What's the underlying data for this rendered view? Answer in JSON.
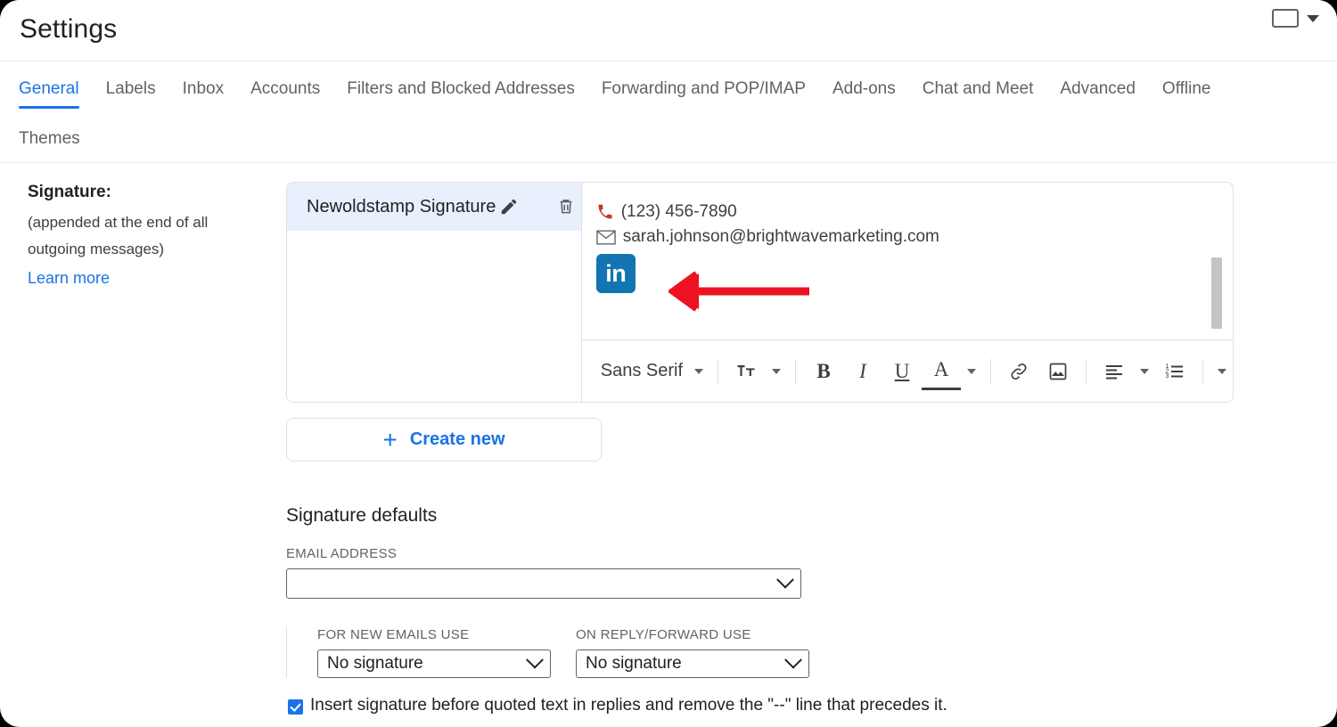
{
  "header": {
    "title": "Settings",
    "keyboard_icon": "keyboard-icon",
    "caret_icon": "chevron-down-icon"
  },
  "tabs": {
    "row1": [
      {
        "label": "General",
        "active": true
      },
      {
        "label": "Labels",
        "active": false
      },
      {
        "label": "Inbox",
        "active": false
      },
      {
        "label": "Accounts",
        "active": false
      },
      {
        "label": "Filters and Blocked Addresses",
        "active": false
      },
      {
        "label": "Forwarding and POP/IMAP",
        "active": false
      },
      {
        "label": "Add-ons",
        "active": false
      },
      {
        "label": "Chat and Meet",
        "active": false
      },
      {
        "label": "Advanced",
        "active": false
      },
      {
        "label": "Offline",
        "active": false
      }
    ],
    "row2": [
      {
        "label": "Themes",
        "active": false
      }
    ]
  },
  "signature_section": {
    "label_title": "Signature:",
    "label_sub_line1": "(appended at the end of all",
    "label_sub_line2": "outgoing messages)",
    "learn_more": "Learn more",
    "list": [
      {
        "name": "Newoldstamp Signature",
        "selected": true
      }
    ],
    "edit_icon": "pencil-icon",
    "delete_icon": "trash-icon",
    "editor": {
      "phone": "(123) 456-7890",
      "email": "sarah.johnson@brightwavemarketing.com",
      "linkedin_label": "in",
      "linkedin_color": "#1275b1",
      "phone_icon": "phone-icon",
      "mail_icon": "envelope-icon",
      "annotation_arrow_color": "#ee1122"
    },
    "toolbar": {
      "font_name": "Sans Serif",
      "text_size_icon": "text-size-icon",
      "bold_label": "B",
      "italic_label": "I",
      "underline_label": "U",
      "text_color_label": "A",
      "link_icon": "link-icon",
      "image_icon": "insert-image-icon",
      "align_icon": "align-left-icon",
      "list_icon": "numbered-list-icon",
      "more_icon": "more-options-icon"
    },
    "create_new": {
      "plus": "+",
      "label": "Create new"
    }
  },
  "signature_defaults": {
    "title": "Signature defaults",
    "email_address_label": "EMAIL ADDRESS",
    "email_address_value": "",
    "new_emails_label": "FOR NEW EMAILS USE",
    "new_emails_value": "No signature",
    "reply_forward_label": "ON REPLY/FORWARD USE",
    "reply_forward_value": "No signature",
    "insert_checkbox_label": "Insert signature before quoted text in replies and remove the \"--\" line that precedes it.",
    "insert_checkbox_checked": true
  },
  "colors": {
    "accent": "#1a73e8",
    "selected_row": "#e8f0fe",
    "text": "#202124",
    "muted": "#5f6368",
    "border": "#e0e0e0",
    "annotation_red": "#ee1122"
  }
}
